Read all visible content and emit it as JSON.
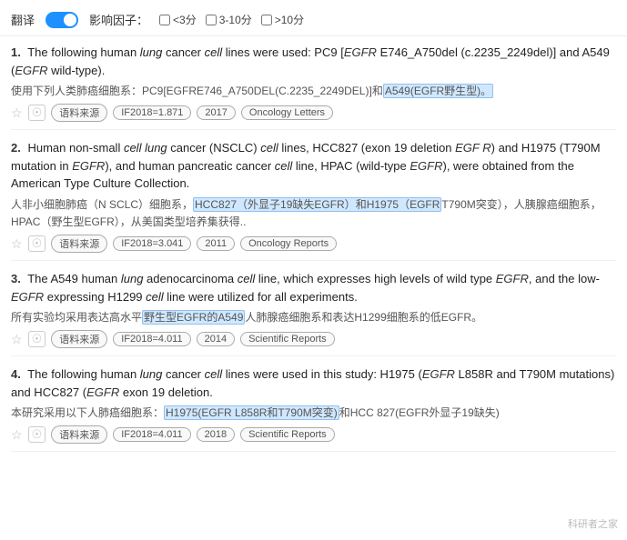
{
  "topbar": {
    "translate_label": "翻译",
    "influence_label": "影响因子：",
    "filter1": "<3分",
    "filter2": "3-10分",
    "filter3": ">10分"
  },
  "results": [
    {
      "num": "1.",
      "en_parts": [
        {
          "text": "The following human ",
          "type": "normal"
        },
        {
          "text": "lung",
          "type": "italic"
        },
        {
          "text": " cancer ",
          "type": "normal"
        },
        {
          "text": "cell",
          "type": "italic"
        },
        {
          "text": " lines were used: PC9 [",
          "type": "normal"
        },
        {
          "text": "EGFR",
          "type": "gene-italic"
        },
        {
          "text": " E746_A750del (c.2235_2249del)] and A549 (",
          "type": "normal"
        },
        {
          "text": "EGFR",
          "type": "gene-italic"
        },
        {
          "text": " wild-type).",
          "type": "normal"
        }
      ],
      "cn_parts": [
        {
          "text": "使用下列人类肺癌细胞系：PC9[EGFRE746_A750DEL(C.2235_2249DEL)]和",
          "type": "normal"
        },
        {
          "text": "A549(EGFR野生型)。",
          "type": "highlight-blue"
        }
      ],
      "meta": {
        "if_value": "IF2018=1.871",
        "year": "2017",
        "journal": "Oncology Letters"
      }
    },
    {
      "num": "2.",
      "en_parts": [
        {
          "text": "Human non-small ",
          "type": "normal"
        },
        {
          "text": "cell lung",
          "type": "italic"
        },
        {
          "text": " cancer (NSCLC) ",
          "type": "normal"
        },
        {
          "text": "cell",
          "type": "italic"
        },
        {
          "text": " lines, HCC827 (exon 19 deletion ",
          "type": "normal"
        },
        {
          "text": "EGF R",
          "type": "gene-italic"
        },
        {
          "text": ") and H1975 (T790M mutation in ",
          "type": "normal"
        },
        {
          "text": "EGFR",
          "type": "gene-italic"
        },
        {
          "text": "), and human pancreatic cancer ",
          "type": "normal"
        },
        {
          "text": "cell",
          "type": "italic"
        },
        {
          "text": " line, HPAC (wild-type ",
          "type": "normal"
        },
        {
          "text": "EGFR",
          "type": "gene-italic"
        },
        {
          "text": "), were obtained from the American Type Culture Collection.",
          "type": "normal"
        }
      ],
      "cn_parts": [
        {
          "text": "人非小细胞肺癌（N SCLC）细胞系，",
          "type": "normal"
        },
        {
          "text": "HCC827（外显子19缺失EGFR）和H1975（EGFR",
          "type": "highlight-blue"
        },
        {
          "text": "T790M突变），人胰腺癌细胞系，HPAC（野生型EGFR），从美国类型培养集获得..",
          "type": "normal"
        }
      ],
      "meta": {
        "if_value": "IF2018=3.041",
        "year": "2011",
        "journal": "Oncology Reports"
      }
    },
    {
      "num": "3.",
      "en_parts": [
        {
          "text": "The A549 human ",
          "type": "normal"
        },
        {
          "text": "lung",
          "type": "italic"
        },
        {
          "text": " adenocarcinoma ",
          "type": "normal"
        },
        {
          "text": "cell",
          "type": "italic"
        },
        {
          "text": " line, which expresses high levels of wild type ",
          "type": "normal"
        },
        {
          "text": "EGFR",
          "type": "gene-italic"
        },
        {
          "text": ", and the low-",
          "type": "normal"
        },
        {
          "text": "EGFR",
          "type": "gene-italic"
        },
        {
          "text": " expressing H1299 ",
          "type": "normal"
        },
        {
          "text": "cell",
          "type": "italic"
        },
        {
          "text": " line were utilized for all experiments.",
          "type": "normal"
        }
      ],
      "cn_parts": [
        {
          "text": "所有实验均采用表达高水平",
          "type": "normal"
        },
        {
          "text": "野生型EGFR的A549",
          "type": "highlight-blue"
        },
        {
          "text": "人肺腺癌细胞系和表达H1299细胞系的低EGFR。",
          "type": "normal"
        }
      ],
      "meta": {
        "if_value": "IF2018=4.011",
        "year": "2014",
        "journal": "Scientific Reports"
      }
    },
    {
      "num": "4.",
      "en_parts": [
        {
          "text": "The following human ",
          "type": "normal"
        },
        {
          "text": "lung",
          "type": "italic"
        },
        {
          "text": " cancer ",
          "type": "normal"
        },
        {
          "text": "cell",
          "type": "italic"
        },
        {
          "text": " lines were used in this study: H1975 (",
          "type": "normal"
        },
        {
          "text": "EGFR",
          "type": "gene-italic"
        },
        {
          "text": " L858R and T790M mutations) and HCC827 (",
          "type": "normal"
        },
        {
          "text": "EGFR",
          "type": "gene-italic"
        },
        {
          "text": " exon 19 deletion.",
          "type": "normal"
        }
      ],
      "cn_parts": [
        {
          "text": "本研究采用以下人肺癌细胞系：",
          "type": "normal"
        },
        {
          "text": "H1975(EGFR L858R和T790M突变)",
          "type": "highlight-blue"
        },
        {
          "text": "和HCC 827(EGFR外显子19缺失)",
          "type": "normal"
        }
      ],
      "meta": {
        "if_value": "IF2018=4.011",
        "year": "2018",
        "journal": "Scientific Reports"
      }
    }
  ],
  "watermark": "科研者之家"
}
